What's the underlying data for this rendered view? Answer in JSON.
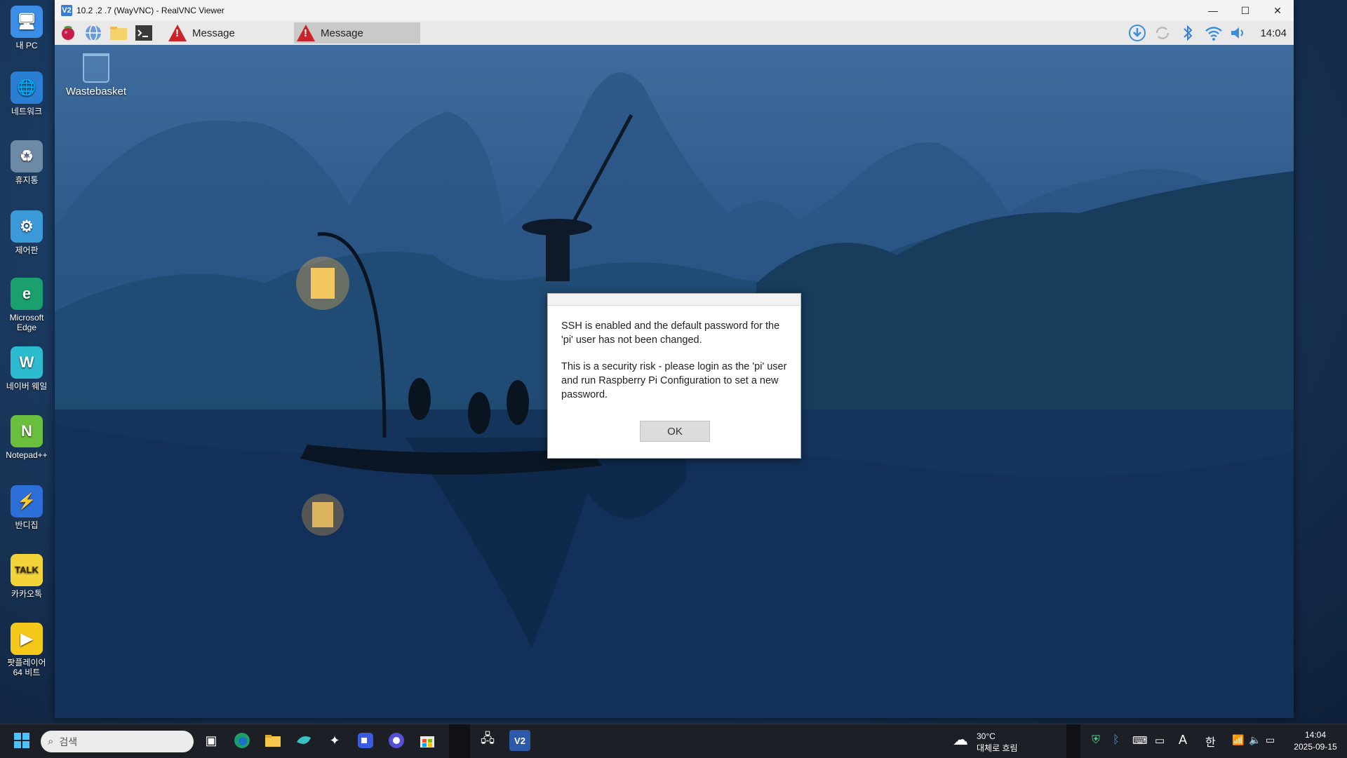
{
  "host_desktop": {
    "icons": [
      {
        "label": "내 PC",
        "glyph": "🖥",
        "color": "#3a8ee6"
      },
      {
        "label": "네트워크",
        "glyph": "🌐",
        "color": "#2a7fd4"
      },
      {
        "label": "휴지통",
        "glyph": "♻",
        "color": "#6d8aa6"
      },
      {
        "label": "제어판",
        "glyph": "⚙",
        "color": "#3d9ad8"
      },
      {
        "label": "Microsoft Edge",
        "glyph": "e",
        "color": "#1aa06d"
      },
      {
        "label": "네이버 웨일",
        "glyph": "W",
        "color": "#2dbbd0"
      },
      {
        "label": "Notepad++",
        "glyph": "N",
        "color": "#6abf3c"
      },
      {
        "label": "반디집",
        "glyph": "⚡",
        "color": "#2c6fd8"
      },
      {
        "label": "카카오톡",
        "glyph": "TALK",
        "color": "#f2d33a"
      },
      {
        "label": "팟플레이어 64 비트",
        "glyph": "▶",
        "color": "#f4c91b"
      }
    ]
  },
  "vnc_window": {
    "title": "10.2   .2   .7  (WayVNC) - RealVNC Viewer",
    "app_icon": "V2",
    "controls": {
      "minimize": "—",
      "maximize": "☐",
      "close": "✕"
    }
  },
  "pi_panel": {
    "launcher_icons": [
      "raspberry-icon",
      "web-browser-icon",
      "file-manager-icon",
      "terminal-icon"
    ],
    "tasks": [
      {
        "label": "Message",
        "active": false
      },
      {
        "label": "Message",
        "active": true
      }
    ],
    "tray_icons": [
      "update-icon",
      "sync-icon",
      "bluetooth-icon",
      "wifi-icon",
      "volume-icon"
    ],
    "clock": "14:04"
  },
  "pi_desktop": {
    "wastebasket_label": "Wastebasket"
  },
  "dialog": {
    "message1": "SSH is enabled and the default password for the 'pi' user has not been changed.",
    "message2": "This is a security risk - please login as the 'pi' user and run Raspberry Pi Configuration to set a new password.",
    "ok_label": "OK"
  },
  "taskbar": {
    "search_placeholder": "검색",
    "weather": {
      "temp": "30°C",
      "desc": "대체로 흐림"
    },
    "time": "14:04",
    "date": "2025-09-15",
    "ime_label": "A",
    "ime_lang": "한"
  }
}
